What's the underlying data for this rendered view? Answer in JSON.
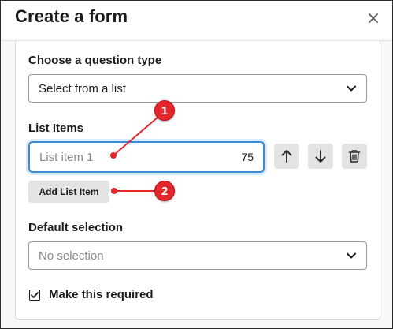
{
  "dialog": {
    "title": "Create a form"
  },
  "question_type": {
    "label": "Choose a question type",
    "selected": "Select from a list"
  },
  "list_items": {
    "label": "List Items",
    "input_placeholder": "List item 1",
    "char_count": "75",
    "add_button_label": "Add List Item"
  },
  "default_selection": {
    "label": "Default selection",
    "placeholder": "No selection"
  },
  "required": {
    "label": "Make this required",
    "checked": true
  },
  "annotations": {
    "badge_1": "1",
    "badge_2": "2",
    "color": "#e5262c"
  },
  "colors": {
    "focus_border": "#3d8bd6",
    "button_bg": "#e3e3e3"
  }
}
